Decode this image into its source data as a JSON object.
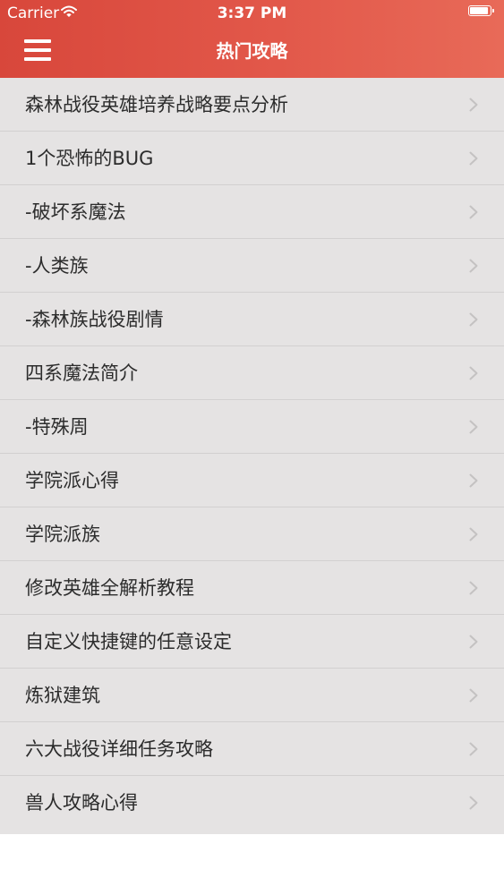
{
  "status_bar": {
    "carrier": "Carrier",
    "time": "3:37 PM",
    "wifi_icon": "wifi-icon",
    "battery_icon": "battery-icon"
  },
  "nav": {
    "title": "热门攻略",
    "menu_icon": "hamburger-menu-icon"
  },
  "list": {
    "items": [
      {
        "label": "森林战役英雄培养战略要点分析"
      },
      {
        "label": "1个恐怖的BUG"
      },
      {
        "label": "-破坏系魔法"
      },
      {
        "label": "-人类族"
      },
      {
        "label": "-森林族战役剧情"
      },
      {
        "label": "四系魔法简介"
      },
      {
        "label": "-特殊周"
      },
      {
        "label": "学院派心得"
      },
      {
        "label": "学院派族"
      },
      {
        "label": "修改英雄全解析教程"
      },
      {
        "label": "自定义快捷键的任意设定"
      },
      {
        "label": "炼狱建筑"
      },
      {
        "label": "六大战役详细任务攻略"
      },
      {
        "label": "兽人攻略心得"
      }
    ],
    "chevron_icon": "chevron-right-icon"
  },
  "colors": {
    "header_start": "#d8473b",
    "header_end": "#e86a58",
    "list_background": "#e5e3e3",
    "separator": "#d2d0d0",
    "text": "#2c2c2c",
    "chevron": "#c4c2c2"
  }
}
